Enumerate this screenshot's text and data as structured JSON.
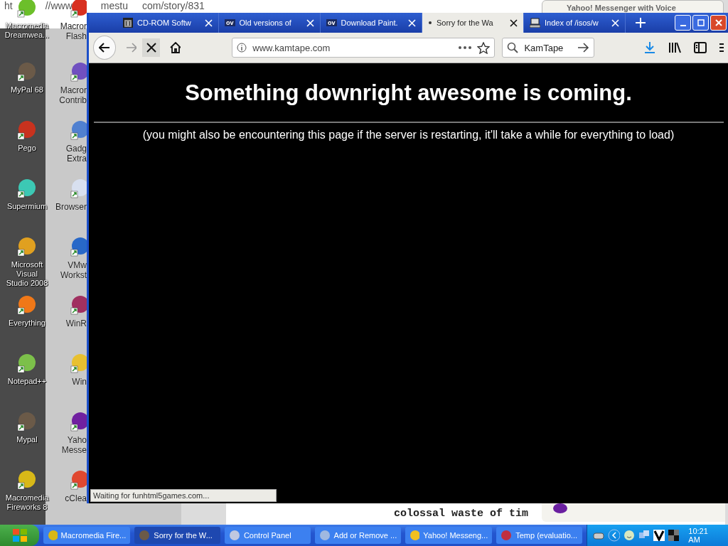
{
  "background_windows": {
    "address_fragments": [
      "ht",
      "//www",
      "mestu",
      "com/story/831"
    ],
    "messenger_title": "Yahoo! Messenger with Voice",
    "document_text": "colossal waste of tim"
  },
  "desktop": {
    "columns": [
      [
        {
          "label": "Macromedia\nDreamwea...",
          "color": "#6cbf2a"
        },
        {
          "label": "MyPal 68",
          "color": "#6b5a48"
        },
        {
          "label": "Pego",
          "color": "#c8321e"
        },
        {
          "label": "Supermium",
          "color": "#3cc8b4"
        },
        {
          "label": "Microsoft Visual\nStudio 2008",
          "color": "#e0a020"
        },
        {
          "label": "Everything",
          "color": "#f07818"
        },
        {
          "label": "Notepad++",
          "color": "#7cc04a"
        },
        {
          "label": "Mypal",
          "color": "#6b5a48"
        },
        {
          "label": "Macromedia\nFireworks 8",
          "color": "#d8b818"
        }
      ],
      [
        {
          "label": "Macror\nFlash",
          "color": "#d83020"
        },
        {
          "label": "Macror\nContrib",
          "color": "#7050c0"
        },
        {
          "label": "Gadg\nExtra",
          "color": "#5080d0"
        },
        {
          "label": "Browser",
          "color": "#d8e0f0"
        },
        {
          "label": "VMw\nWorkst",
          "color": "#2868c8"
        },
        {
          "label": "WinR",
          "color": "#a03060"
        },
        {
          "label": "Win",
          "color": "#e8c030"
        },
        {
          "label": "Yaho\nMesse",
          "color": "#7020a0"
        },
        {
          "label": "cClea",
          "color": "#e04830"
        }
      ]
    ]
  },
  "browser": {
    "tabs": [
      {
        "title": "CD-ROM Softw",
        "kind": "building",
        "selected": false
      },
      {
        "title": "Old versions of",
        "kind": "badge",
        "badge": "ov",
        "selected": false
      },
      {
        "title": "Download Paint.",
        "kind": "badge",
        "badge": "ov",
        "selected": false
      },
      {
        "title": "Sorry for the Wa",
        "kind": "loading",
        "selected": true
      },
      {
        "title": "Index of /isos/w",
        "kind": "computer",
        "selected": false
      }
    ],
    "address": "www.kamtape.com",
    "search": "KamTape",
    "heading": "Something downright awesome is coming.",
    "message": "(you might also be encountering this page if the server is restarting, it'll take a while for everything to load)",
    "status": "Waiting for funhtml5games.com..."
  },
  "taskbar": {
    "tasks": [
      {
        "label": "Macromedia Fire...",
        "color": "#d8b818",
        "selected": false
      },
      {
        "label": "Sorry for the W...",
        "color": "#6b5a48",
        "selected": true
      },
      {
        "label": "Control Panel",
        "color": "#c0c8e0",
        "selected": false
      },
      {
        "label": "Add or Remove ...",
        "color": "#a0b8e0",
        "selected": false
      },
      {
        "label": "Yahoo! Messeng...",
        "color": "#f0c020",
        "selected": false
      },
      {
        "label": "Temp (evaluatio...",
        "color": "#c03040",
        "selected": false
      }
    ],
    "clock": "10:21 AM"
  }
}
